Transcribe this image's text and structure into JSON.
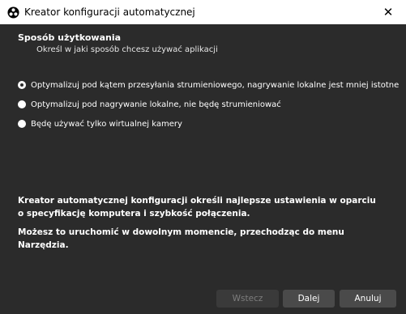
{
  "window": {
    "title": "Kreator konfiguracji automatycznej",
    "close_glyph": "✕",
    "icon": "obs-logo-icon"
  },
  "section": {
    "heading": "Sposób użytkowania",
    "subheading": "Określ w jaki sposób chcesz używać aplikacji"
  },
  "options": [
    {
      "label": "Optymalizuj pod kątem przesyłania strumieniowego, nagrywanie lokalne jest mniej istotne",
      "selected": true
    },
    {
      "label": "Optymalizuj pod nagrywanie lokalne, nie będę strumieniować",
      "selected": false
    },
    {
      "label": "Będę używać tylko wirtualnej kamery",
      "selected": false
    }
  ],
  "info": {
    "line1": "Kreator automatycznej konfiguracji określi najlepsze ustawienia w oparciu o specyfikację komputera i szybkość połączenia.",
    "line2": "Możesz to uruchomić w dowolnym momencie, przechodząc do menu Narzędzia."
  },
  "buttons": {
    "back": "Wstecz",
    "next": "Dalej",
    "cancel": "Anuluj"
  },
  "colors": {
    "background": "#2b2b2b",
    "titlebar": "#ffffff",
    "button": "#4a4a4a",
    "button_disabled": "#3a3a3a"
  }
}
